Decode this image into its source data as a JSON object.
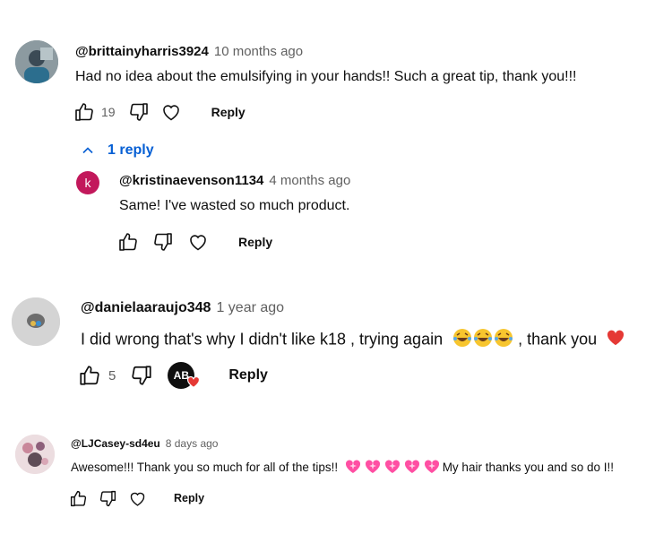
{
  "comments": [
    {
      "handle": "@brittainyharris3924",
      "time": "10 months ago",
      "text": "Had no idea about the emulsifying in your hands!! Such a great tip, thank you!!!",
      "likes": "19",
      "reply_label": "Reply",
      "replies_toggle": "1 reply",
      "reply": {
        "handle": "@kristinaevenson1134",
        "time": "4 months ago",
        "text": "Same! I've wasted so much product.",
        "avatar_letter": "k",
        "reply_label": "Reply"
      }
    },
    {
      "handle": "@danielaaraujo348",
      "time": "1 year ago",
      "text": "I did wrong that's why I didn't like k18 , trying again",
      "text_tail": " , thank you",
      "likes": "5",
      "creator_initials": "AB",
      "reply_label": "Reply"
    },
    {
      "handle": "@LJCasey-sd4eu",
      "time": "8 days ago",
      "text": "Awesome!!! Thank you so much for all of the tips!!",
      "text_tail": "  My hair thanks you and so do I!!",
      "reply_label": "Reply"
    }
  ],
  "colors": {
    "link_blue": "#065fd4",
    "reply_avatar_bg": "#c2185b",
    "heart_red": "#e53935",
    "sparkle_heart_pink": "#ff4fa3"
  },
  "icons": [
    "thumbs-up-icon",
    "thumbs-down-icon",
    "heart-outline-icon",
    "chevron-up-icon",
    "laughing-emoji",
    "red-heart-emoji",
    "sparkling-heart-emoji"
  ]
}
